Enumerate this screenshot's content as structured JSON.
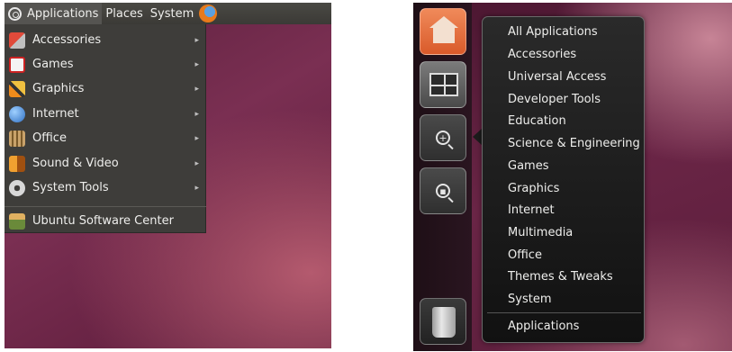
{
  "left": {
    "panel": {
      "applications_label": "Applications",
      "places_label": "Places",
      "system_label": "System"
    },
    "menu_items": [
      {
        "label": "Accessories",
        "icon": "accessories-icon"
      },
      {
        "label": "Games",
        "icon": "games-icon"
      },
      {
        "label": "Graphics",
        "icon": "graphics-icon"
      },
      {
        "label": "Internet",
        "icon": "internet-icon"
      },
      {
        "label": "Office",
        "icon": "office-icon"
      },
      {
        "label": "Sound & Video",
        "icon": "sound-video-icon"
      },
      {
        "label": "System Tools",
        "icon": "system-tools-icon"
      }
    ],
    "software_center_label": "Ubuntu Software Center",
    "submenu_arrow": "▸"
  },
  "right": {
    "launcher": [
      "home-folder-icon",
      "workspaces-icon",
      "applications-lens-icon",
      "files-lens-icon",
      "trash-icon"
    ],
    "quicklist": [
      "All Applications",
      "Accessories",
      "Universal Access",
      "Developer Tools",
      "Education",
      "Science & Engineering",
      "Games",
      "Graphics",
      "Internet",
      "Multimedia",
      "Office",
      "Themes & Tweaks",
      "System"
    ],
    "quicklist_footer": "Applications"
  }
}
